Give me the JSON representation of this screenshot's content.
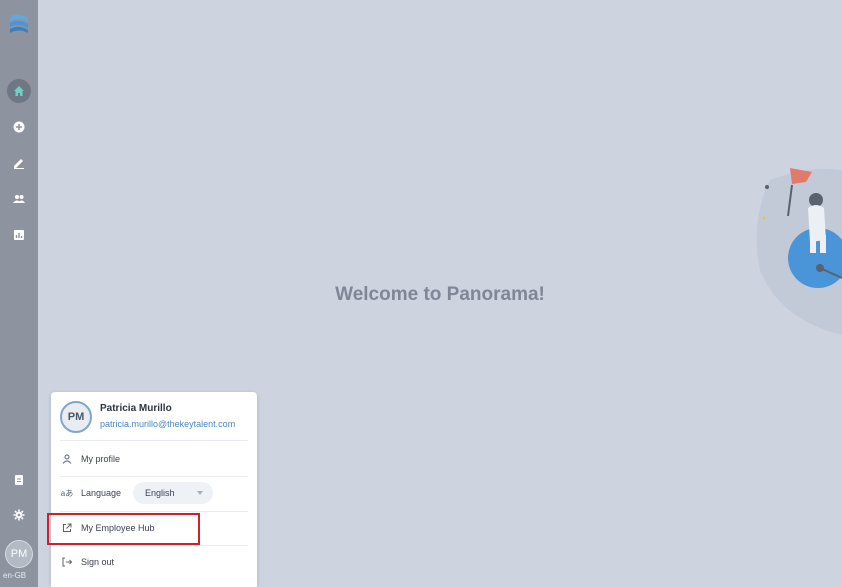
{
  "app": {
    "welcome_text": "Welcome to Panorama!",
    "locale": "en-GB",
    "accent_color": "#4a86c5",
    "highlight_color": "#d0202a"
  },
  "sidebar": {
    "logo": "panorama-logo-icon",
    "nav": [
      {
        "name": "home",
        "icon": "home-icon",
        "active": true
      },
      {
        "name": "add",
        "icon": "plus-circle-icon"
      },
      {
        "name": "edit",
        "icon": "pencil-icon"
      },
      {
        "name": "people",
        "icon": "people-icon"
      },
      {
        "name": "reports",
        "icon": "chart-icon"
      }
    ],
    "bottom": [
      {
        "name": "documents",
        "icon": "document-icon"
      },
      {
        "name": "settings",
        "icon": "gear-icon"
      }
    ],
    "avatar_initials": "PM"
  },
  "user_menu": {
    "initials": "PM",
    "name": "Patricia Murillo",
    "email": "patricia.murillo@thekeytalent.com",
    "items": {
      "profile": "My profile",
      "language_label": "Language",
      "language_value": "English",
      "employee_hub": "My Employee Hub",
      "sign_out": "Sign out"
    }
  }
}
